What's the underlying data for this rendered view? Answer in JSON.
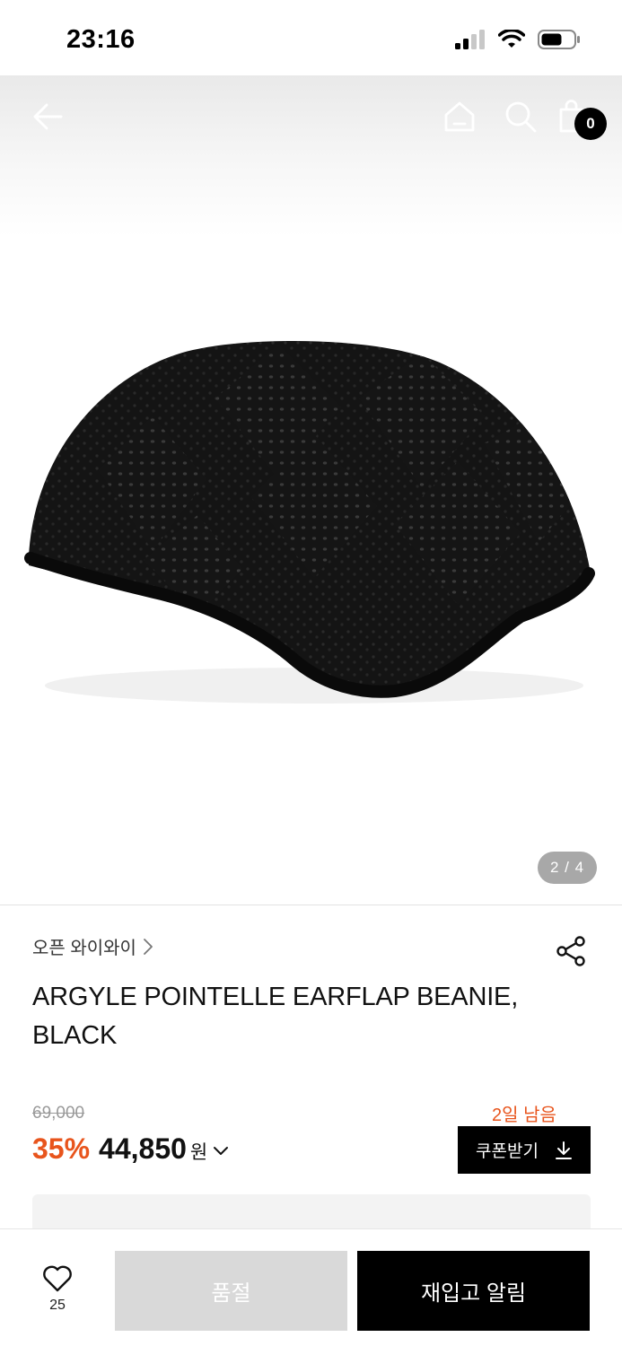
{
  "status_bar": {
    "time": "23:16"
  },
  "top_nav": {
    "bag_count": "0",
    "icons": [
      "back-arrow-icon",
      "home-icon",
      "search-icon",
      "shopping-bag-icon"
    ]
  },
  "gallery": {
    "page_indicator": "2 / 4"
  },
  "product": {
    "brand": "오픈 와이와이",
    "title": "ARGYLE POINTELLE EARFLAP BEANIE, BLACK",
    "original_price": "69,000",
    "discount": "35%",
    "sale_price": "44,850",
    "currency": "원",
    "days_left": "2일 남음",
    "coupon_label": "쿠폰받기"
  },
  "bottom_bar": {
    "like_count": "25",
    "soldout_label": "품절",
    "restock_label": "재입고 알림"
  },
  "colors": {
    "accent": "#e8541c",
    "primary": "#000000",
    "disabled": "#d9d9d9"
  }
}
